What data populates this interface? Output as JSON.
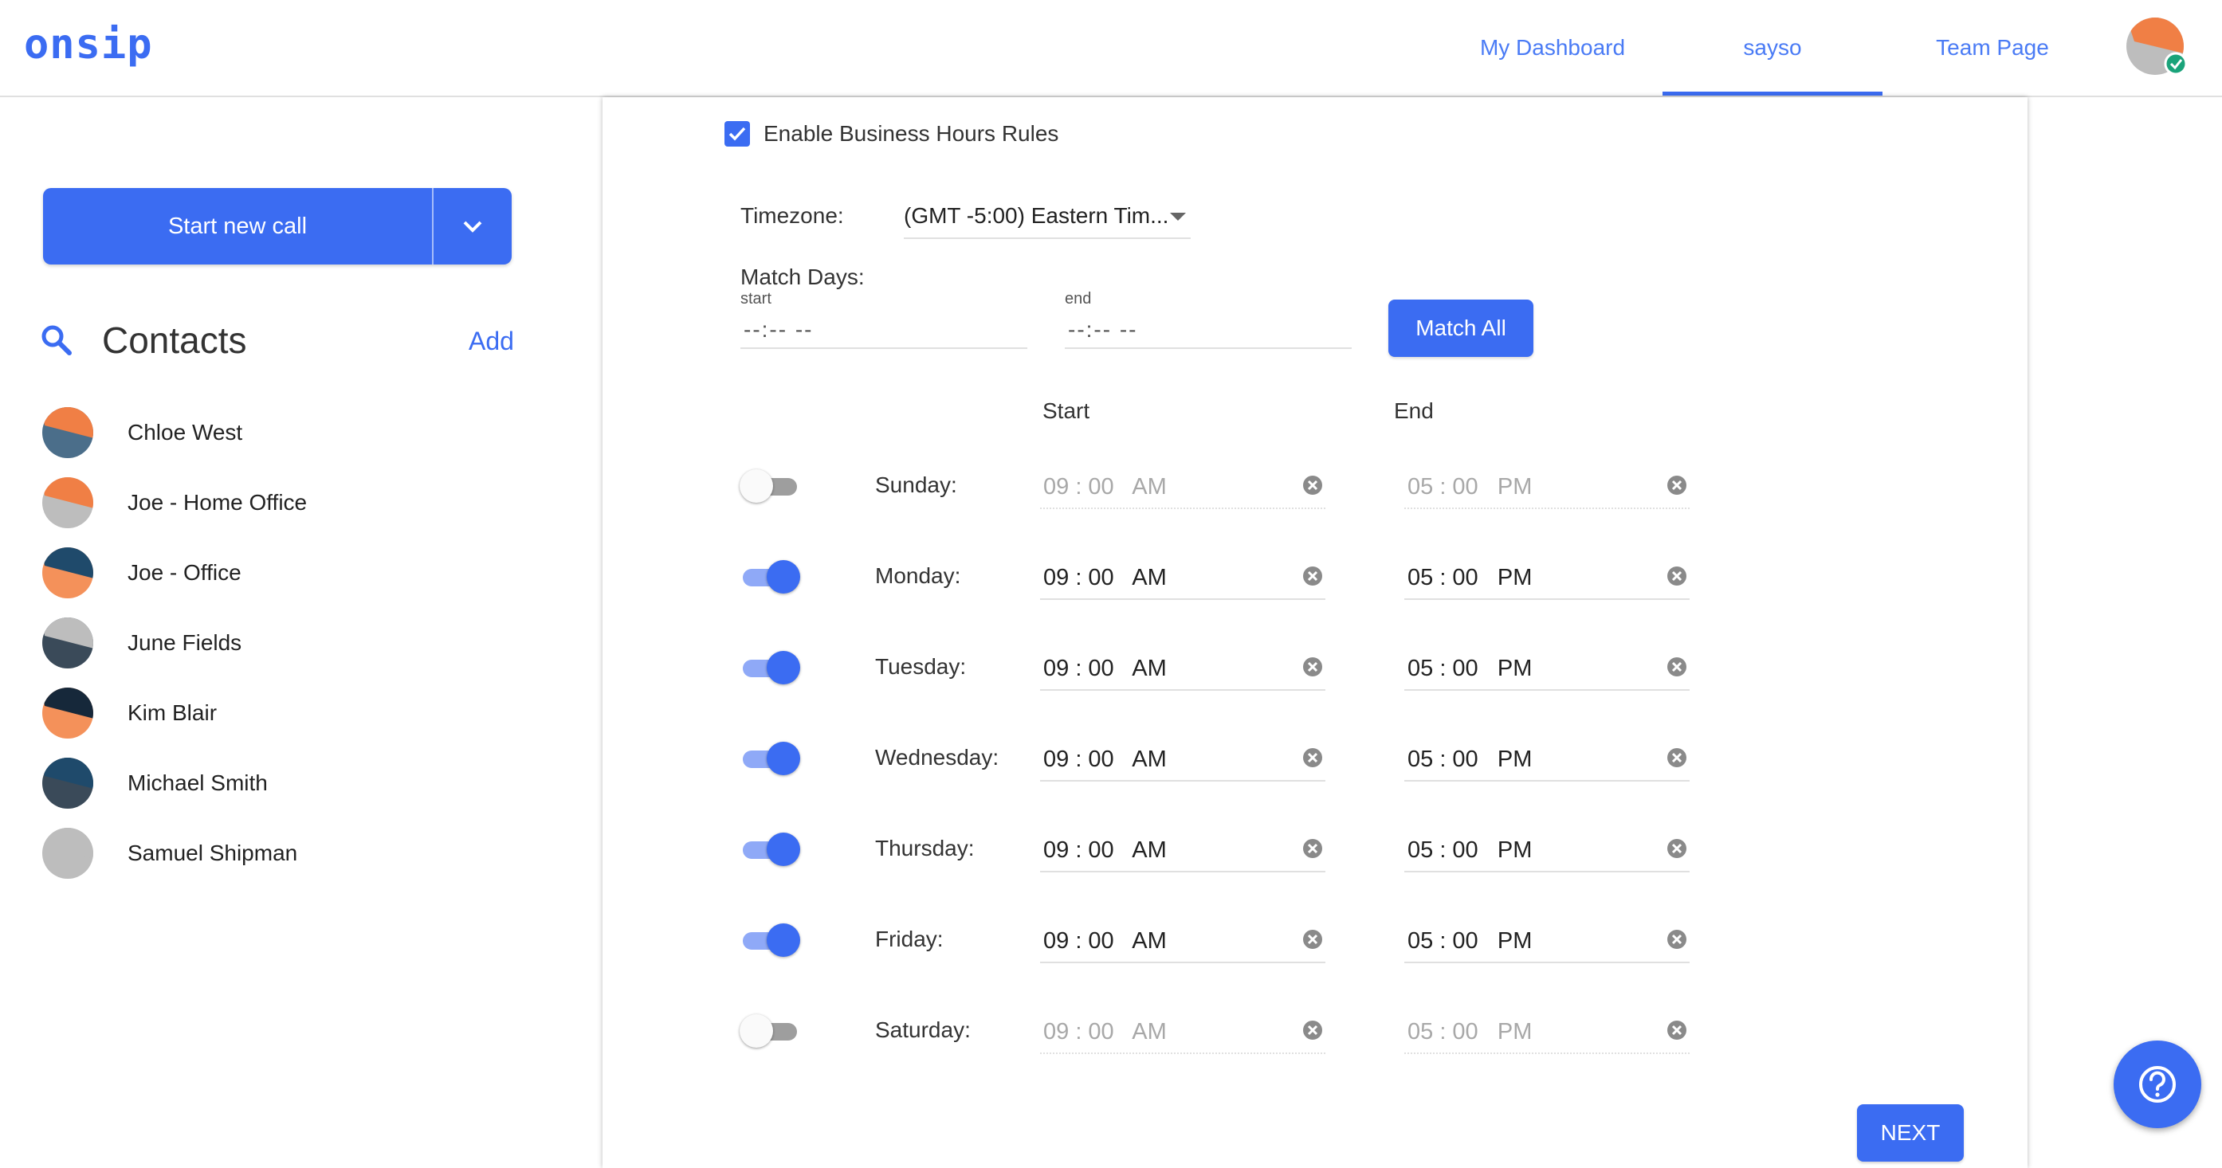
{
  "colors": {
    "accent": "#3b6cf2",
    "orange": "#f07f45",
    "navy": "#2b4f6e",
    "grey": "#bdbdbd"
  },
  "header": {
    "logo": "onsip",
    "tabs": [
      {
        "label": "My Dashboard",
        "active": false
      },
      {
        "label": "sayso",
        "active": true
      },
      {
        "label": "Team Page",
        "active": false
      }
    ],
    "avatar_status": "online"
  },
  "sidebar": {
    "start_call_label": "Start new call",
    "contacts_title": "Contacts",
    "add_label": "Add",
    "contacts": [
      {
        "name": "Chloe West",
        "avatar": [
          "#f07f45",
          "#4b6e8a"
        ]
      },
      {
        "name": "Joe - Home Office",
        "avatar": [
          "#f07f45",
          "#bdbdbd"
        ]
      },
      {
        "name": "Joe - Office",
        "avatar": [
          "#1f4a6b",
          "#f4915a"
        ]
      },
      {
        "name": "June Fields",
        "avatar": [
          "#bdbdbd",
          "#3a4a59"
        ]
      },
      {
        "name": "Kim Blair",
        "avatar": [
          "#16283a",
          "#f4915a"
        ]
      },
      {
        "name": "Michael Smith",
        "avatar": [
          "#1f4a6b",
          "#3a4a59"
        ]
      },
      {
        "name": "Samuel Shipman",
        "avatar": [
          "#bdbdbd",
          "#bdbdbd"
        ]
      }
    ]
  },
  "main": {
    "enable_label": "Enable Business Hours Rules",
    "enable_checked": true,
    "timezone_label": "Timezone:",
    "timezone_value": "(GMT -5:00) Eastern Tim...",
    "match_days_label": "Match Days:",
    "match_start_label": "start",
    "match_start_value": "--:-- --",
    "match_end_label": "end",
    "match_end_value": "--:-- --",
    "match_all_label": "Match All",
    "start_header": "Start",
    "end_header": "End",
    "days": [
      {
        "label": "Sunday:",
        "enabled": false,
        "start": "09 : 00   AM",
        "end": "05 : 00   PM"
      },
      {
        "label": "Monday:",
        "enabled": true,
        "start": "09 : 00   AM",
        "end": "05 : 00   PM"
      },
      {
        "label": "Tuesday:",
        "enabled": true,
        "start": "09 : 00   AM",
        "end": "05 : 00   PM"
      },
      {
        "label": "Wednesday:",
        "enabled": true,
        "start": "09 : 00   AM",
        "end": "05 : 00   PM"
      },
      {
        "label": "Thursday:",
        "enabled": true,
        "start": "09 : 00   AM",
        "end": "05 : 00   PM"
      },
      {
        "label": "Friday:",
        "enabled": true,
        "start": "09 : 00   AM",
        "end": "05 : 00   PM"
      },
      {
        "label": "Saturday:",
        "enabled": false,
        "start": "09 : 00   AM",
        "end": "05 : 00   PM"
      }
    ],
    "next_label": "NEXT"
  }
}
